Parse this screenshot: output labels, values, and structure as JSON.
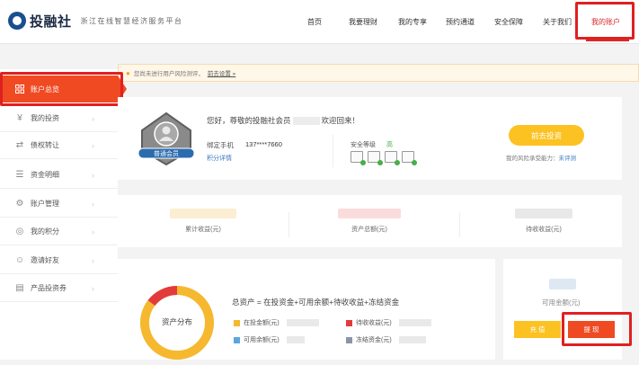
{
  "brand": {
    "name": "投融社",
    "slogan": "浙江在线智慧经济服务平台"
  },
  "nav": {
    "items": [
      "首页",
      "我要理财",
      "我的专享",
      "预约通道",
      "安全保障",
      "关于我们",
      "我的账户"
    ],
    "active": "我的账户"
  },
  "sidebar": {
    "items": [
      {
        "label": "账户总览",
        "icon": "grid-icon"
      },
      {
        "label": "我的投资",
        "icon": "yen-icon"
      },
      {
        "label": "债权转让",
        "icon": "transfer-icon"
      },
      {
        "label": "资金明细",
        "icon": "document-icon"
      },
      {
        "label": "账户管理",
        "icon": "user-gear-icon"
      },
      {
        "label": "我的积分",
        "icon": "points-icon"
      },
      {
        "label": "邀请好友",
        "icon": "invite-icon"
      },
      {
        "label": "产品投资券",
        "icon": "coupon-icon"
      }
    ],
    "active": 0
  },
  "notice": {
    "text": "您尚未进行用户风险测评，",
    "link": "前去设置 »"
  },
  "profile": {
    "badge": "普通会员",
    "greeting_prefix": "您好，尊敬的投融社会员",
    "greeting_suffix": "欢迎回来！",
    "phone_label": "绑定手机",
    "phone_value": "137****7660",
    "points_link": "积分详情",
    "security_label": "安全等级",
    "security_value": "高",
    "invest_button": "前去投资",
    "risk_text": "我的风险承受能力：",
    "risk_link": "未评测"
  },
  "stats": [
    {
      "label": "累计收益(元)"
    },
    {
      "label": "资产总额(元)"
    },
    {
      "label": "待收收益(元)"
    }
  ],
  "assets": {
    "chart_label": "资产分布",
    "formula": "总资产 = 在投资金+可用余额+待收收益+冻结资金",
    "legend": [
      {
        "label": "在投金额(元)",
        "color": "#f5b82e"
      },
      {
        "label": "待收收益(元)",
        "color": "#e23b3b"
      },
      {
        "label": "可用余额(元)",
        "color": "#5aa7e0"
      },
      {
        "label": "冻结资金(元)",
        "color": "#8a96a8"
      }
    ],
    "available_label": "可用金额(元)",
    "recharge_button": "充 值",
    "withdraw_button": "提 现"
  },
  "colors": {
    "accent": "#f04a23",
    "highlight_box": "#e02020",
    "gold": "#fcc222"
  }
}
